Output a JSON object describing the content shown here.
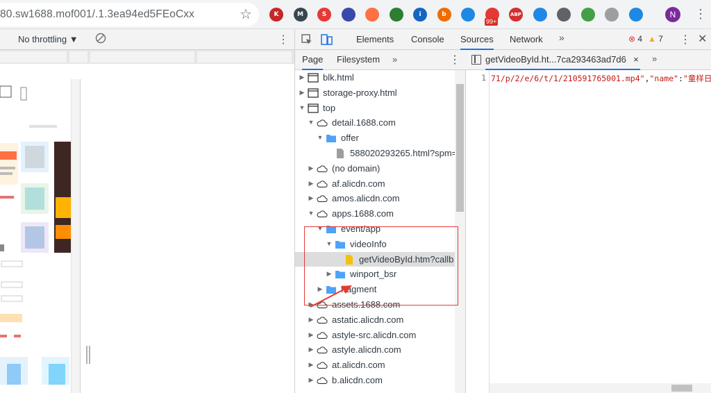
{
  "browser": {
    "url": "80.sw1688.mof001/.1.3ea94ed5FEoCxx",
    "extensions": [
      {
        "name": "k-extension-icon",
        "letter": "K",
        "color": "#c62828"
      },
      {
        "name": "m-extension-icon",
        "letter": "M",
        "color": "#37474f"
      },
      {
        "name": "seo-extension-icon",
        "letter": "S",
        "color": "#e53935"
      },
      {
        "name": "swirl-extension-icon",
        "letter": "",
        "color": "#3949ab"
      },
      {
        "name": "wifi-extension-icon",
        "letter": "",
        "color": "#ff7043"
      },
      {
        "name": "evernote-extension-icon",
        "letter": "",
        "color": "#2e7d32"
      },
      {
        "name": "info-extension-icon",
        "letter": "i",
        "color": "#1565c0"
      },
      {
        "name": "b-extension-icon",
        "letter": "b",
        "color": "#ef6c00"
      },
      {
        "name": "feed-extension-icon",
        "letter": "",
        "color": "#1e88e5"
      },
      {
        "name": "mail-extension-icon",
        "letter": "",
        "color": "#e53935"
      },
      {
        "name": "adblock-extension-icon",
        "letter": "ABP",
        "color": "#d32f2f"
      },
      {
        "name": "download-extension-icon",
        "letter": "",
        "color": "#1e88e5"
      },
      {
        "name": "diamond-extension-icon",
        "letter": "",
        "color": "#5f6368"
      },
      {
        "name": "sprout-extension-icon",
        "letter": "",
        "color": "#43a047"
      },
      {
        "name": "puzzle-extension-icon",
        "letter": "",
        "color": "#9e9e9e"
      },
      {
        "name": "globe-extension-icon",
        "letter": "",
        "color": "#1e88e5"
      }
    ],
    "extension_badge": "99+",
    "profile_initial": "N"
  },
  "device_toolbar": {
    "throttle": "No throttling ▼"
  },
  "devtools": {
    "tabs": [
      "Elements",
      "Console",
      "Sources",
      "Network"
    ],
    "active_tab": "Sources",
    "more_tabs": "»",
    "errors": "4",
    "warnings": "7",
    "nav_tabs": [
      "Page",
      "Filesystem"
    ],
    "nav_more": "»",
    "tree": [
      {
        "label": "blk.html",
        "icon": "window",
        "arrow": "▶"
      },
      {
        "label": "storage-proxy.html",
        "icon": "window",
        "arrow": "▶"
      },
      {
        "label": "top",
        "icon": "window",
        "arrow": "▼"
      },
      {
        "label": "detail.1688.com",
        "icon": "cloud",
        "arrow": "▼"
      },
      {
        "label": "offer",
        "icon": "folder",
        "arrow": "▼"
      },
      {
        "label": "588020293265.html?spm=",
        "icon": "file",
        "arrow": ""
      },
      {
        "label": "(no domain)",
        "icon": "cloud",
        "arrow": "▶"
      },
      {
        "label": "af.alicdn.com",
        "icon": "cloud",
        "arrow": "▶"
      },
      {
        "label": "amos.alicdn.com",
        "icon": "cloud",
        "arrow": "▶"
      },
      {
        "label": "apps.1688.com",
        "icon": "cloud",
        "arrow": "▼"
      },
      {
        "label": "event/app",
        "icon": "folder",
        "arrow": "▼"
      },
      {
        "label": "videoInfo",
        "icon": "folder",
        "arrow": "▼"
      },
      {
        "label": "getVideoById.htm?callb",
        "icon": "file-yellow",
        "arrow": ""
      },
      {
        "label": "winport_bsr",
        "icon": "folder",
        "arrow": "▶"
      },
      {
        "label": "fragment",
        "icon": "folder",
        "arrow": "▶"
      },
      {
        "label": "assets.1688.com",
        "icon": "cloud",
        "arrow": "▶"
      },
      {
        "label": "astatic.alicdn.com",
        "icon": "cloud",
        "arrow": "▶"
      },
      {
        "label": "astyle-src.alicdn.com",
        "icon": "cloud",
        "arrow": "▶"
      },
      {
        "label": "astyle.alicdn.com",
        "icon": "cloud",
        "arrow": "▶"
      },
      {
        "label": "at.alicdn.com",
        "icon": "cloud",
        "arrow": "▶"
      },
      {
        "label": "b.alicdn.com",
        "icon": "cloud",
        "arrow": "▶"
      }
    ],
    "editor": {
      "file_tab": "getVideoById.ht...7ca293463ad7d6",
      "close_glyph": "×",
      "more": "»",
      "line_number": "1",
      "code_value": "71/p/2/e/6/t/1/210591765001.mp4\"",
      "code_comma": ",",
      "code_key": "\"name\"",
      "code_colon": ":",
      "code_value2": "\"童样日"
    }
  }
}
